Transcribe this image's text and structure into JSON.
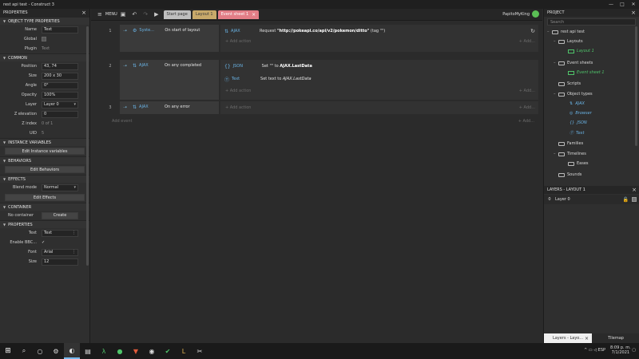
{
  "window": {
    "title": "rest api test - Construct 3",
    "controls": [
      "—",
      "□",
      "✕"
    ]
  },
  "left_panel": {
    "header": "PROPERTIES",
    "sections": {
      "object_type": "OBJECT TYPE PROPERTIES",
      "common": "COMMON",
      "instance_vars": "INSTANCE VARIABLES",
      "behaviors": "BEHAVIORS",
      "effects": "EFFECTS",
      "container": "CONTAINER",
      "properties": "PROPERTIES"
    },
    "name_label": "Name",
    "name_value": "Text",
    "global_label": "Global",
    "plugin_label": "Plugin",
    "plugin_value": "Text",
    "position_label": "Position",
    "position_value": "43, 74",
    "size_label": "Size",
    "size_value": "200 x 30",
    "angle_label": "Angle",
    "angle_value": "0°",
    "opacity_label": "Opacity",
    "opacity_value": "100%",
    "layer_label": "Layer",
    "layer_value": "Layer 0",
    "zelev_label": "Z elevation",
    "zelev_value": "0",
    "zindex_label": "Z index",
    "zindex_value": "0 of 1",
    "uid_label": "UID",
    "uid_value": "5",
    "edit_instance_vars": "Edit Instance variables",
    "edit_behaviors": "Edit Behaviors",
    "blend_label": "Blend mode",
    "blend_value": "Normal",
    "edit_effects": "Edit Effects",
    "no_container": "No container",
    "create": "Create",
    "text_label": "Text",
    "text_value": "Text",
    "bbcode_label": "Enable BBC...",
    "font_label": "Font",
    "font_value": "Arial",
    "fsize_label": "Size",
    "fsize_value": "12"
  },
  "toolbar": {
    "menu": "MENU",
    "tabs": {
      "start": "Start page",
      "layout": "Layout 1",
      "event": "Event sheet 1"
    },
    "user": "PapitoMyKing"
  },
  "events": [
    {
      "num": "1",
      "object": "Syste...",
      "condition": "On start of layout",
      "actions": [
        {
          "object": "AJAX",
          "text_pre": "Request ",
          "text_bold": "\"http://pokeapi.co/api/v2/pokemon/ditto\"",
          "text_post": " (tag \"\")"
        }
      ]
    },
    {
      "num": "2",
      "object": "AJAX",
      "condition": "On any completed",
      "actions": [
        {
          "object": "JSON",
          "text_pre": "Set \"\" to ",
          "text_bold": "AJAX.LastData",
          "text_post": ""
        },
        {
          "object": "Text",
          "text_pre": "Set text to ",
          "text_bold": "AJAX.LastData",
          "text_post": ""
        }
      ]
    },
    {
      "num": "3",
      "object": "AJAX",
      "condition": "On any error",
      "actions": []
    }
  ],
  "add_action": "Add action",
  "add_short": "+ Add...",
  "add_event": "Add event",
  "project": {
    "header": "PROJECT",
    "search_placeholder": "Search",
    "root": "rest api test",
    "layouts": "Layouts",
    "layout1": "Layout 1",
    "event_sheets": "Event sheets",
    "event_sheet1": "Event sheet 1",
    "scripts": "Scripts",
    "object_types": "Object types",
    "obj_ajax": "AJAX",
    "obj_browser": "Browser",
    "obj_json": "JSON",
    "obj_text": "Text",
    "families": "Families",
    "timelines": "Timelines",
    "eases": "Eases",
    "sounds": "Sounds"
  },
  "layers": {
    "header": "LAYERS - LAYOUT 1",
    "row_num": "0",
    "row_name": "Layer 0",
    "tab1": "Layers - Layo...",
    "tab2": "Tilemap"
  },
  "taskbar": {
    "lang": "ESP",
    "time": "8:09 p. m.",
    "date": "7/1/2021"
  },
  "colors": {
    "active_tab": "#e27d86",
    "object_blue": "#6ab4e6",
    "project_green": "#4fc46a"
  }
}
